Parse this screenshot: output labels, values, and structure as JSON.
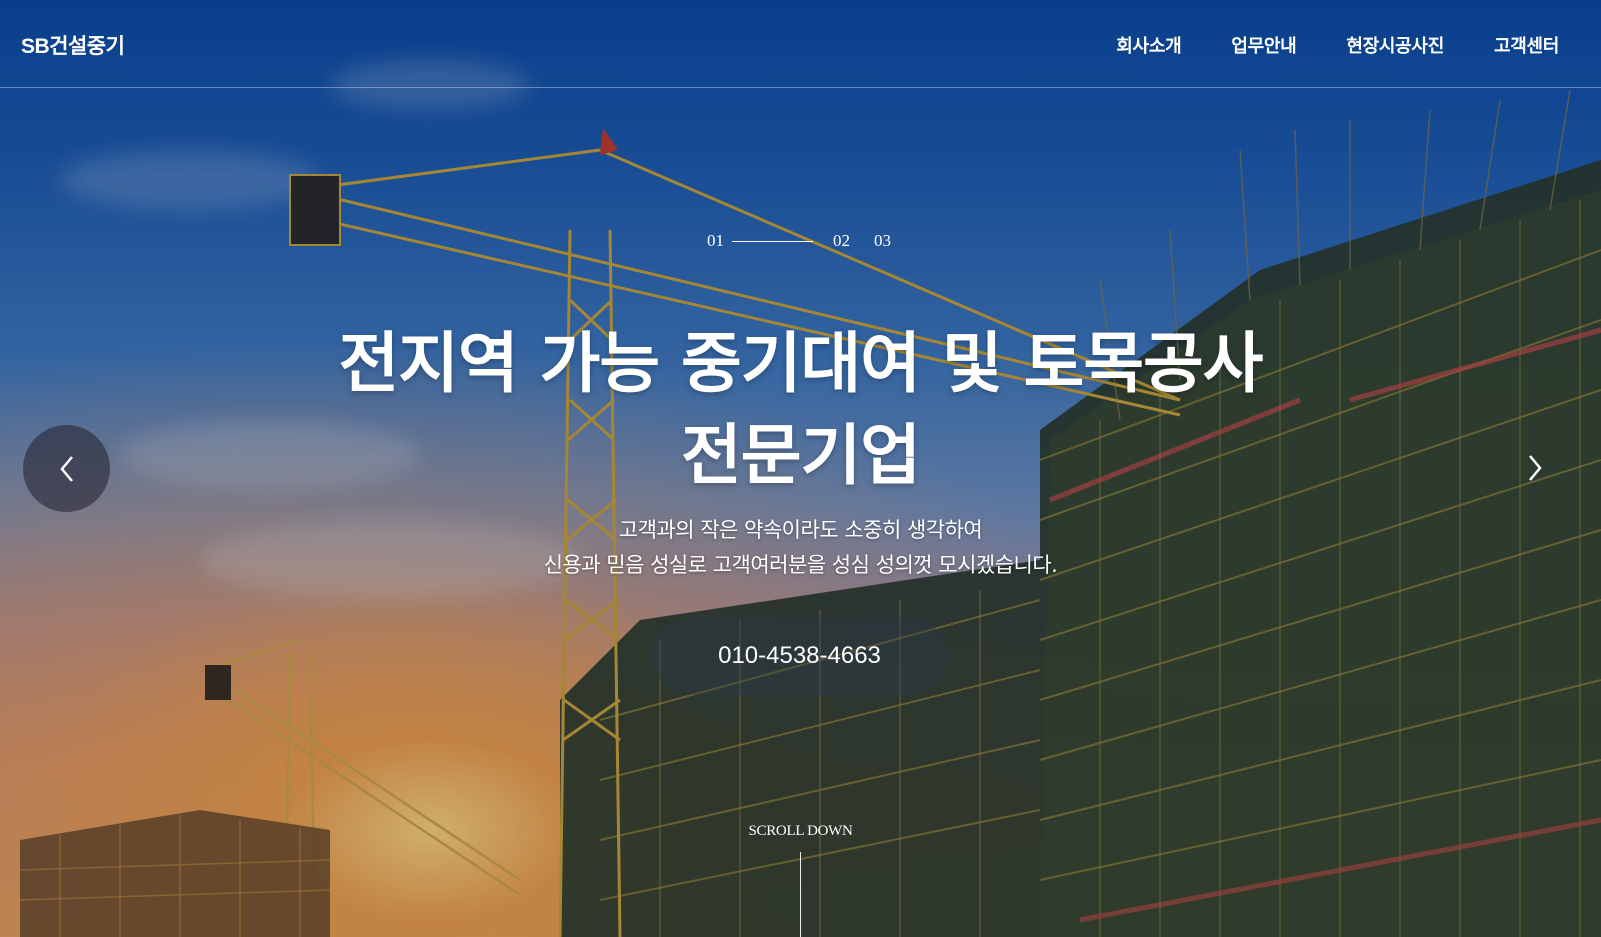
{
  "header": {
    "logo": "SB건설중기",
    "nav": [
      {
        "label": "회사소개"
      },
      {
        "label": "업무안내"
      },
      {
        "label": "현장시공사진"
      },
      {
        "label": "고객센터"
      }
    ]
  },
  "slider": {
    "pages": [
      "01",
      "02",
      "03"
    ],
    "active_index": 0
  },
  "hero": {
    "title_line1": "전지역 가능 중기대여 및 토목공사",
    "title_line2": "전문기업",
    "subtitle_line1": "고객과의 작은 약속이라도 소중히 생각하여",
    "subtitle_line2": "신용과 믿음 성실로 고객여러분을 성심 성의껏 모시겠습니다.",
    "phone": "010-4538-4663"
  },
  "scroll": {
    "label": "SCROLL DOWN"
  },
  "icons": {
    "prev": "chevron-left-icon",
    "next": "chevron-right-icon"
  }
}
